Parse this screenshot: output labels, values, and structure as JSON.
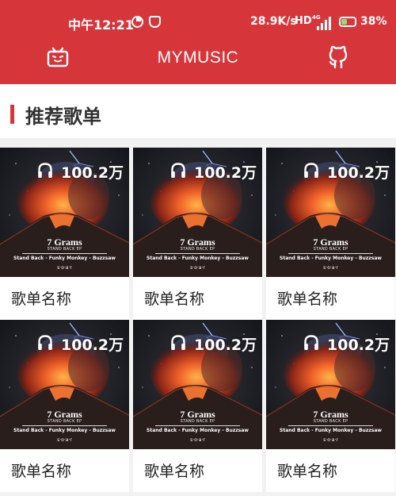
{
  "status_bar": {
    "time": "中午12:21",
    "net_speed": "28.9K/s",
    "hd": "HD",
    "network": "4G",
    "battery": "38%"
  },
  "app_bar": {
    "title": "MYMUSIC",
    "left_icon": "tv-icon",
    "right_icon": "github-icon",
    "color": "#d6353a"
  },
  "section": {
    "title": "推荐歌单"
  },
  "playlists": [
    {
      "name": "歌单名称",
      "play_count": "100.2万",
      "cover": {
        "title": "7 Grams",
        "subtitle": "STAND BACK EP",
        "tracks": "Stand Back - Funky Monkey - Buzzsaw",
        "label": "s·o·a·r"
      }
    },
    {
      "name": "歌单名称",
      "play_count": "100.2万",
      "cover": {
        "title": "7 Grams",
        "subtitle": "STAND BACK EP",
        "tracks": "Stand Back - Funky Monkey - Buzzsaw",
        "label": "s·o·a·r"
      }
    },
    {
      "name": "歌单名称",
      "play_count": "100.2万",
      "cover": {
        "title": "7 Grams",
        "subtitle": "STAND BACK EP",
        "tracks": "Stand Back - Funky Monkey - Buzzsaw",
        "label": "s·o·a·r"
      }
    },
    {
      "name": "歌单名称",
      "play_count": "100.2万",
      "cover": {
        "title": "7 Grams",
        "subtitle": "STAND BACK EP",
        "tracks": "Stand Back - Funky Monkey - Buzzsaw",
        "label": "s·o·a·r"
      }
    },
    {
      "name": "歌单名称",
      "play_count": "100.2万",
      "cover": {
        "title": "7 Grams",
        "subtitle": "STAND BACK EP",
        "tracks": "Stand Back - Funky Monkey - Buzzsaw",
        "label": "s·o·a·r"
      }
    },
    {
      "name": "歌单名称",
      "play_count": "100.2万",
      "cover": {
        "title": "7 Grams",
        "subtitle": "STAND BACK EP",
        "tracks": "Stand Back - Funky Monkey - Buzzsaw",
        "label": "s·o·a·r"
      }
    }
  ]
}
